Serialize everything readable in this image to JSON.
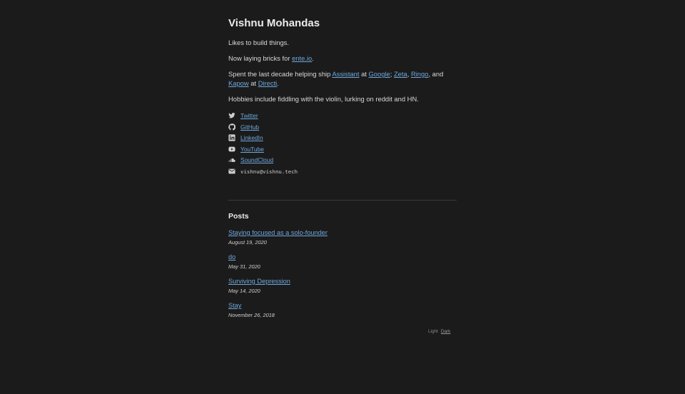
{
  "header": {
    "name": "Vishnu Mohandas"
  },
  "intro": {
    "tagline": "Likes to build things.",
    "now_prefix": "Now laying bricks for ",
    "now_link": "ente.io",
    "now_suffix": ".",
    "past_prefix": "Spent the last decade helping ship ",
    "past_link_assistant": "Assistant",
    "past_at1": " at ",
    "past_link_google": "Google",
    "past_sep1": "; ",
    "past_link_zeta": "Zeta",
    "past_sep2": ", ",
    "past_link_ringo": "Ringo",
    "past_sep3": ", and ",
    "past_link_kapow": "Kapow",
    "past_at2": " at ",
    "past_link_directi": "Directi",
    "past_suffix": ".",
    "hobbies": "Hobbies include fiddling with the violin, lurking on reddit and HN."
  },
  "social": [
    {
      "label": "Twitter",
      "icon": "twitter-icon"
    },
    {
      "label": "GitHub",
      "icon": "github-icon"
    },
    {
      "label": "LinkedIn",
      "icon": "linkedin-icon"
    },
    {
      "label": "YouTube",
      "icon": "youtube-icon"
    },
    {
      "label": "SoundCloud",
      "icon": "soundcloud-icon"
    }
  ],
  "email": {
    "address": "vishnu@vishnu.tech",
    "icon": "mail-icon"
  },
  "posts": {
    "heading": "Posts",
    "items": [
      {
        "title": "Staying focused as a solo-founder",
        "date": "August 19, 2020"
      },
      {
        "title": "do",
        "date": "May 31, 2020"
      },
      {
        "title": "Surviving Depression",
        "date": "May 14, 2020"
      },
      {
        "title": "Stay",
        "date": "November 26, 2018"
      }
    ]
  },
  "theme": {
    "light_label": "Light",
    "dark_label": "Dark"
  },
  "colors": {
    "background": "#1b1b1b",
    "link": "#6ea8dc",
    "text": "#dcdcdc"
  }
}
